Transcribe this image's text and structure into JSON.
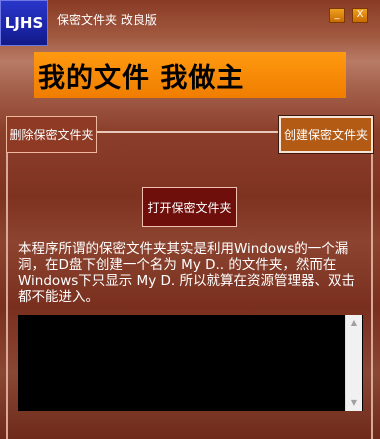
{
  "window": {
    "logo_text": "LJHS",
    "title": "保密文件夹 改良版",
    "minimize_label": "_",
    "close_label": "X"
  },
  "banner": {
    "text": "我的文件  我做主"
  },
  "buttons": {
    "delete_label": "删除保密文件夹",
    "create_label": "创建保密文件夹",
    "open_label": "打开保密文件夹"
  },
  "description": "本程序所谓的保密文件夹其实是利用Windows的一个漏洞，在D盘下创建一个名为 My D.. 的文件夹，然而在Windows下只显示 My D. 所以就算在资源管理器、双击都不能进入。",
  "log": {
    "content": ""
  },
  "colors": {
    "logo_blue": "#1b25a8",
    "banner_orange": "#f58a08",
    "accent": "#6e0f0b"
  }
}
